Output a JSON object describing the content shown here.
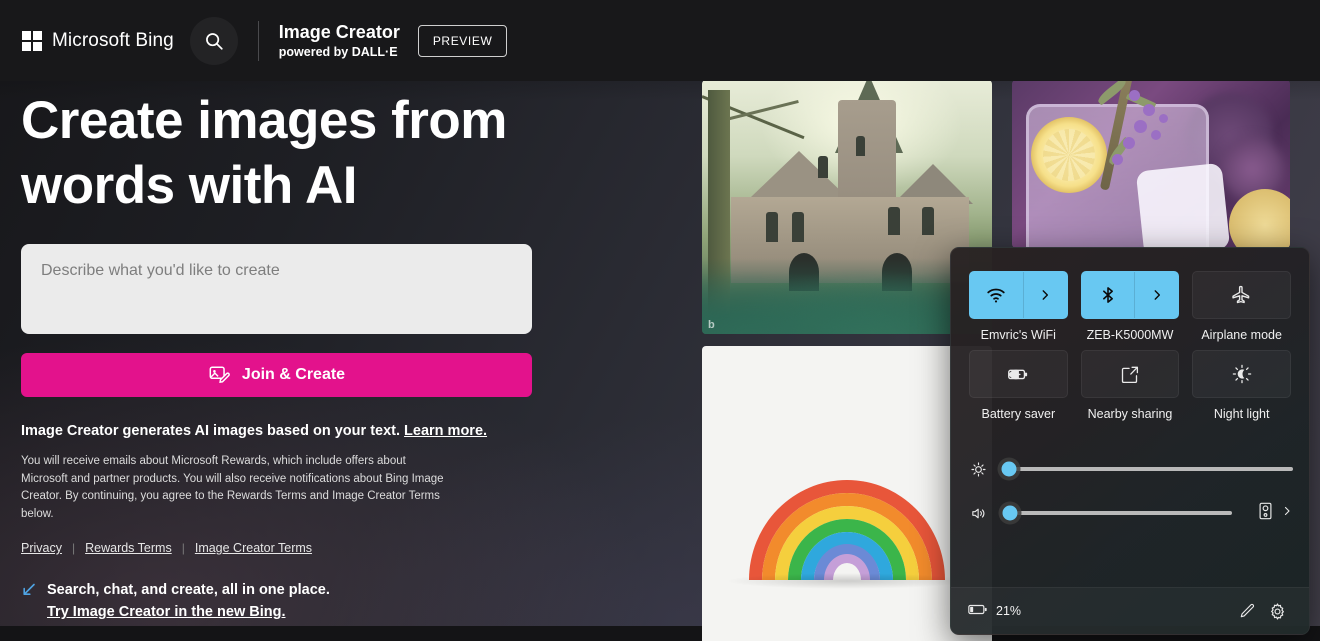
{
  "header": {
    "brand_name": "Microsoft Bing",
    "search_icon": "search-icon",
    "logo_icon": "microsoft-logo-icon",
    "app_title": "Image Creator",
    "app_subtitle": "powered by DALL·E",
    "preview_badge": "PREVIEW"
  },
  "hero": {
    "title_line1": "Create images from",
    "title_line2": "words with AI",
    "prompt_placeholder": "Describe what you'd like to create",
    "prompt_value": "",
    "cta_label": "Join & Create",
    "cta_icon": "image-edit-icon",
    "cta_color": "#e3128c",
    "tagline_text": "Image Creator generates AI images based on your text.",
    "tagline_link": "Learn more.",
    "legal_paragraph": "You will receive emails about Microsoft Rewards, which include offers about Microsoft and partner products. You will also receive notifications about Bing Image Creator. By continuing, you agree to the Rewards Terms and Image Creator Terms below.",
    "legal_links": [
      "Privacy",
      "Rewards Terms",
      "Image Creator Terms"
    ],
    "promo_icon": "bing-chat-icon",
    "promo_line1": "Search, chat, and create, all in one place.",
    "promo_link": "Try Image Creator in the new Bing."
  },
  "gallery": {
    "items": [
      {
        "name": "fairytale-mansion-in-forest",
        "watermark": "b"
      },
      {
        "name": "lavender-lemon-cocktail",
        "watermark": ""
      },
      {
        "name": "papercraft-rainbow",
        "watermark": ""
      }
    ],
    "rainbow_colors": [
      "#e8563a",
      "#f28b2c",
      "#f5cf3d",
      "#3bb54a",
      "#2fa8dd",
      "#6b8ad6",
      "#c59fd8"
    ]
  },
  "quick_settings": {
    "accent_color": "#68c8f2",
    "tiles": [
      {
        "label": "Emvric's WiFi",
        "icon": "wifi-icon",
        "state": "on",
        "has_chevron": true
      },
      {
        "label": "ZEB-K5000MW",
        "icon": "bluetooth-icon",
        "state": "on",
        "has_chevron": true
      },
      {
        "label": "Airplane mode",
        "icon": "airplane-icon",
        "state": "off",
        "has_chevron": false
      },
      {
        "label": "Battery saver",
        "icon": "battery-saver-icon",
        "state": "off",
        "has_chevron": false
      },
      {
        "label": "Nearby sharing",
        "icon": "nearby-sharing-icon",
        "state": "off",
        "has_chevron": false
      },
      {
        "label": "Night light",
        "icon": "night-light-icon",
        "state": "off",
        "has_chevron": false
      }
    ],
    "sliders": [
      {
        "name": "brightness",
        "icon": "brightness-icon",
        "value": 2,
        "min": 0,
        "max": 100
      },
      {
        "name": "volume",
        "icon": "volume-icon",
        "value": 3,
        "min": 0,
        "max": 100
      }
    ],
    "volume_output_icon": "speaker-device-icon",
    "volume_output_chevron": "chevron-right-icon",
    "footer": {
      "battery_icon": "battery-icon",
      "battery_text": "21%",
      "edit_icon": "pencil-icon",
      "settings_icon": "gear-icon"
    }
  }
}
